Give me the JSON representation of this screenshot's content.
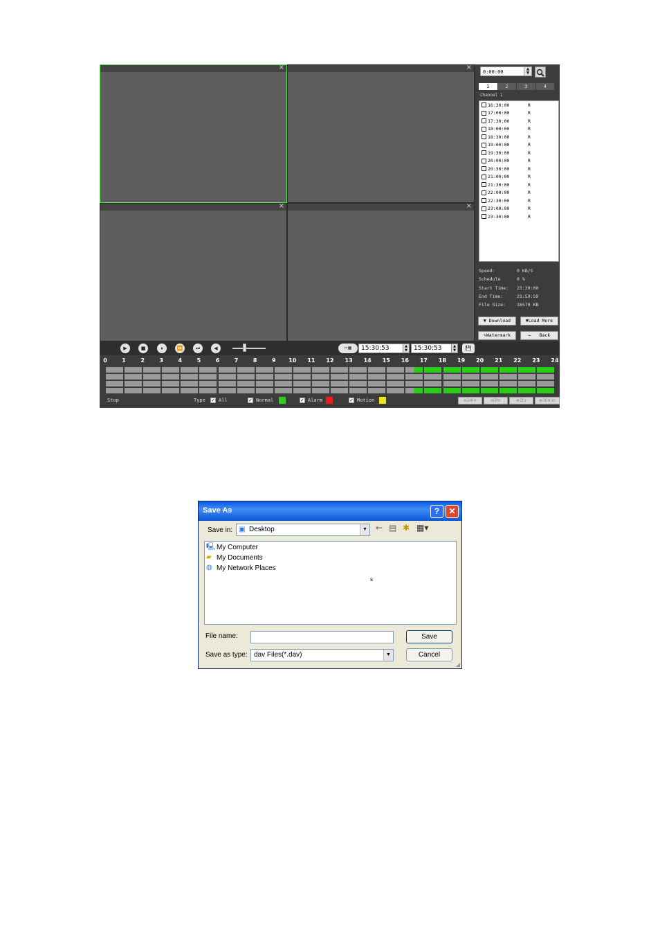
{
  "player": {
    "viewport_close": "×",
    "search": {
      "time_value": "0:00:00"
    },
    "channel_tabs": [
      "1",
      "2",
      "3",
      "4"
    ],
    "channel_label": "Channel 1",
    "files": [
      {
        "time": "16:30:00",
        "type": "R"
      },
      {
        "time": "17:00:00",
        "type": "R"
      },
      {
        "time": "17:30:00",
        "type": "R"
      },
      {
        "time": "18:00:00",
        "type": "R"
      },
      {
        "time": "18:30:00",
        "type": "R"
      },
      {
        "time": "19:00:00",
        "type": "R"
      },
      {
        "time": "19:30:00",
        "type": "R"
      },
      {
        "time": "20:00:00",
        "type": "R"
      },
      {
        "time": "20:30:00",
        "type": "R"
      },
      {
        "time": "21:00:00",
        "type": "R"
      },
      {
        "time": "21:30:00",
        "type": "R"
      },
      {
        "time": "22:00:00",
        "type": "R"
      },
      {
        "time": "22:30:00",
        "type": "R"
      },
      {
        "time": "23:00:00",
        "type": "R"
      },
      {
        "time": "23:30:00",
        "type": "R"
      }
    ],
    "info": {
      "speed_label": "Speed:",
      "speed": "0 KB/S",
      "schedule_label": "Schedule",
      "schedule": "0 %",
      "start_label": "Start Time:",
      "start": "23:30:00",
      "end_label": "End Time:",
      "end": "23:59:59",
      "size_label": "File Size:",
      "size": "18570 KB"
    },
    "buttons": {
      "download": "Download",
      "load_more": "Load More",
      "watermark": "Watermark",
      "back": "Back"
    },
    "clip": {
      "start": "15:30:53",
      "end": "15:30:53"
    },
    "timeline_hours": [
      "0",
      "1",
      "2",
      "3",
      "4",
      "5",
      "6",
      "7",
      "8",
      "9",
      "10",
      "11",
      "12",
      "13",
      "14",
      "15",
      "16",
      "17",
      "18",
      "19",
      "20",
      "21",
      "22",
      "23",
      "24"
    ],
    "recorded_from_hour": 16.5,
    "status": "Stop",
    "type_label": "Type",
    "filters": [
      {
        "label": "All",
        "checked": true
      },
      {
        "label": "Normal",
        "checked": true,
        "color": "#2ecc1a"
      },
      {
        "label": "Alarm",
        "checked": true,
        "color": "#ee1c1c"
      },
      {
        "label": "Motion",
        "checked": true,
        "color": "#e6e619"
      }
    ],
    "zoom": [
      "24hr",
      "2hr",
      "1hr",
      "30min"
    ],
    "colors": {
      "recorded": "#2ecc1a",
      "empty": "#9a9a9a",
      "selected_border": "#5ae04a"
    }
  },
  "dialog": {
    "title": "Save As",
    "save_in_label": "Save in:",
    "save_in_value": "Desktop",
    "items": [
      "My Computer",
      "My Documents",
      "My Network Places"
    ],
    "stray_char": "s",
    "file_name_label": "File name:",
    "file_name_value": "",
    "save_as_type_label": "Save as type:",
    "save_as_type_value": "dav Files(*.dav)",
    "save_button": "Save",
    "cancel_button": "Cancel"
  }
}
